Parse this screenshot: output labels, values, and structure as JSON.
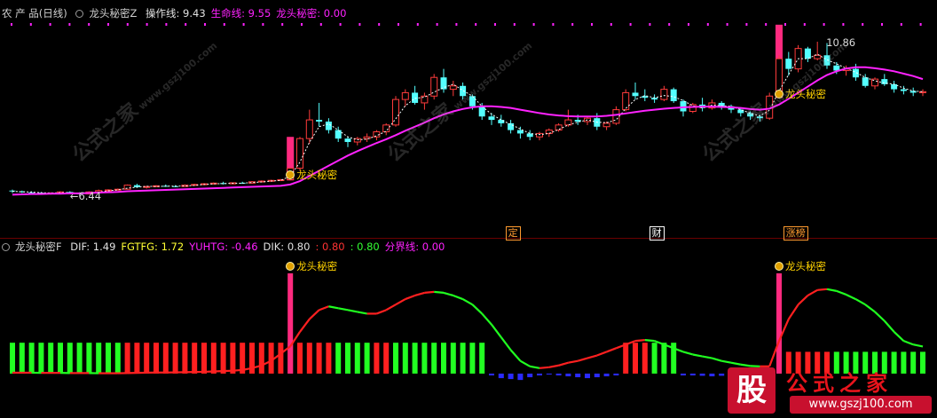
{
  "window": {
    "product": "农 产 品(日线)",
    "main_indicator": "龙头秘密Z",
    "main_items": [
      {
        "text": "操作线: 9.43",
        "color": "#e0e0e0"
      },
      {
        "text": "生命线: 9.55",
        "color": "#ff22ff"
      },
      {
        "text": "龙头秘密: 0.00",
        "color": "#ff22ff"
      }
    ],
    "sub_indicator": "龙头秘密F",
    "sub_items": [
      {
        "text": "DIF: 1.49",
        "color": "#e0e0e0"
      },
      {
        "text": "FGTFG: 1.72",
        "color": "#ffff33"
      },
      {
        "text": "YUHTG: -0.46",
        "color": "#ff22ff"
      },
      {
        "text": "DIK: 0.80",
        "color": "#e0e0e0"
      },
      {
        "text": ": 0.80",
        "color": "#ff3333"
      },
      {
        "text": ": 0.80",
        "color": "#33ff33"
      },
      {
        "text": "分界线: 0.00",
        "color": "#ff22ff"
      }
    ]
  },
  "chart_data": [
    {
      "type": "candlestick",
      "price_range": [
        5.6,
        11.5
      ],
      "high_label": "10.86",
      "low_label": "6.44",
      "signal_label": "龙头秘密",
      "colors": {
        "up": "#ff3b3b",
        "down": "#54ffff",
        "life_line": "#ff22ff",
        "op_line": "#ffffff"
      },
      "candles": [
        [
          6.52,
          6.55,
          6.45,
          6.5
        ],
        [
          6.5,
          6.52,
          6.45,
          6.47
        ],
        [
          6.47,
          6.5,
          6.43,
          6.46
        ],
        [
          6.46,
          6.48,
          6.42,
          6.44
        ],
        [
          6.44,
          6.47,
          6.4,
          6.45
        ],
        [
          6.45,
          6.5,
          6.43,
          6.48
        ],
        [
          6.48,
          6.5,
          6.42,
          6.44
        ],
        [
          6.44,
          6.47,
          6.4,
          6.42
        ],
        [
          6.42,
          6.5,
          6.41,
          6.48
        ],
        [
          6.48,
          6.55,
          6.46,
          6.52
        ],
        [
          6.52,
          6.56,
          6.5,
          6.54
        ],
        [
          6.54,
          6.58,
          6.52,
          6.56
        ],
        [
          6.56,
          6.7,
          6.55,
          6.68
        ],
        [
          6.68,
          6.72,
          6.6,
          6.62
        ],
        [
          6.62,
          6.66,
          6.58,
          6.64
        ],
        [
          6.64,
          6.68,
          6.62,
          6.66
        ],
        [
          6.66,
          6.7,
          6.63,
          6.65
        ],
        [
          6.65,
          6.68,
          6.62,
          6.64
        ],
        [
          6.64,
          6.7,
          6.63,
          6.68
        ],
        [
          6.68,
          6.72,
          6.66,
          6.7
        ],
        [
          6.7,
          6.74,
          6.68,
          6.72
        ],
        [
          6.72,
          6.76,
          6.7,
          6.74
        ],
        [
          6.74,
          6.78,
          6.7,
          6.72
        ],
        [
          6.72,
          6.76,
          6.7,
          6.75
        ],
        [
          6.75,
          6.78,
          6.72,
          6.74
        ],
        [
          6.74,
          6.8,
          6.73,
          6.78
        ],
        [
          6.78,
          6.82,
          6.76,
          6.8
        ],
        [
          6.8,
          6.84,
          6.78,
          6.82
        ],
        [
          6.82,
          6.86,
          6.8,
          6.84
        ],
        [
          6.84,
          7.2,
          6.82,
          7.18
        ],
        [
          7.18,
          8.1,
          7.1,
          8.05
        ],
        [
          8.05,
          8.9,
          7.9,
          8.6
        ],
        [
          8.6,
          9.1,
          8.4,
          8.55
        ],
        [
          8.55,
          8.65,
          8.2,
          8.3
        ],
        [
          8.3,
          8.4,
          7.95,
          8.05
        ],
        [
          8.05,
          8.1,
          7.8,
          7.95
        ],
        [
          7.95,
          8.1,
          7.85,
          8.05
        ],
        [
          8.05,
          8.2,
          7.95,
          8.1
        ],
        [
          8.1,
          8.3,
          8.0,
          8.25
        ],
        [
          8.25,
          8.5,
          8.15,
          8.45
        ],
        [
          8.45,
          9.3,
          8.4,
          9.2
        ],
        [
          9.2,
          9.5,
          9.0,
          9.4
        ],
        [
          9.4,
          9.6,
          9.05,
          9.1
        ],
        [
          9.1,
          9.4,
          8.9,
          9.3
        ],
        [
          9.3,
          9.95,
          9.2,
          9.85
        ],
        [
          9.85,
          10.1,
          9.4,
          9.5
        ],
        [
          9.5,
          9.75,
          9.3,
          9.6
        ],
        [
          9.6,
          9.7,
          9.2,
          9.3
        ],
        [
          9.3,
          9.35,
          8.9,
          9.0
        ],
        [
          9.0,
          9.1,
          8.6,
          8.7
        ],
        [
          8.7,
          8.8,
          8.45,
          8.6
        ],
        [
          8.6,
          8.75,
          8.4,
          8.5
        ],
        [
          8.5,
          8.6,
          8.2,
          8.3
        ],
        [
          8.3,
          8.4,
          8.05,
          8.2
        ],
        [
          8.2,
          8.3,
          8.0,
          8.1
        ],
        [
          8.1,
          8.25,
          8.0,
          8.2
        ],
        [
          8.2,
          8.35,
          8.1,
          8.3
        ],
        [
          8.3,
          8.5,
          8.25,
          8.45
        ],
        [
          8.45,
          8.9,
          8.4,
          8.6
        ],
        [
          8.6,
          8.75,
          8.45,
          8.55
        ],
        [
          8.55,
          8.7,
          8.45,
          8.65
        ],
        [
          8.65,
          8.8,
          8.3,
          8.4
        ],
        [
          8.4,
          8.55,
          8.3,
          8.5
        ],
        [
          8.5,
          9.0,
          8.45,
          8.9
        ],
        [
          8.9,
          9.5,
          8.85,
          9.4
        ],
        [
          9.4,
          9.7,
          9.2,
          9.3
        ],
        [
          9.3,
          9.5,
          9.15,
          9.25
        ],
        [
          9.25,
          9.35,
          9.1,
          9.2
        ],
        [
          9.2,
          9.6,
          9.15,
          9.5
        ],
        [
          9.5,
          9.55,
          9.1,
          9.15
        ],
        [
          9.15,
          9.2,
          8.7,
          8.85
        ],
        [
          8.85,
          9.1,
          8.8,
          9.05
        ],
        [
          9.05,
          9.25,
          8.85,
          8.95
        ],
        [
          8.95,
          9.2,
          8.9,
          9.1
        ],
        [
          9.1,
          9.15,
          8.9,
          9.0
        ],
        [
          9.0,
          9.05,
          8.8,
          8.9
        ],
        [
          8.9,
          8.95,
          8.7,
          8.8
        ],
        [
          8.8,
          8.85,
          8.6,
          8.7
        ],
        [
          8.7,
          8.75,
          8.55,
          8.65
        ],
        [
          8.65,
          9.4,
          8.6,
          9.3
        ],
        [
          9.3,
          10.5,
          9.25,
          10.4
        ],
        [
          10.4,
          10.6,
          9.9,
          10.1
        ],
        [
          10.1,
          10.8,
          10.0,
          10.7
        ],
        [
          10.7,
          10.75,
          10.3,
          10.4
        ],
        [
          10.4,
          10.9,
          10.35,
          10.5
        ],
        [
          10.5,
          10.86,
          10.1,
          10.2
        ],
        [
          10.2,
          10.3,
          9.95,
          10.05
        ],
        [
          10.05,
          10.2,
          9.9,
          10.1
        ],
        [
          10.1,
          10.25,
          9.75,
          9.85
        ],
        [
          9.85,
          9.95,
          9.55,
          9.6
        ],
        [
          9.6,
          9.85,
          9.5,
          9.8
        ],
        [
          9.8,
          9.95,
          9.6,
          9.65
        ],
        [
          9.65,
          9.75,
          9.4,
          9.5
        ],
        [
          9.5,
          9.6,
          9.35,
          9.45
        ],
        [
          9.45,
          9.55,
          9.3,
          9.4
        ],
        [
          9.4,
          9.5,
          9.3,
          9.43
        ]
      ],
      "life_line": [
        6.4,
        6.41,
        6.42,
        6.42,
        6.43,
        6.43,
        6.44,
        6.44,
        6.45,
        6.46,
        6.47,
        6.48,
        6.5,
        6.51,
        6.52,
        6.53,
        6.54,
        6.55,
        6.56,
        6.57,
        6.58,
        6.59,
        6.6,
        6.61,
        6.62,
        6.63,
        6.64,
        6.65,
        6.66,
        6.7,
        6.8,
        6.95,
        7.1,
        7.25,
        7.4,
        7.55,
        7.68,
        7.8,
        7.92,
        8.03,
        8.15,
        8.28,
        8.4,
        8.52,
        8.65,
        8.76,
        8.85,
        8.92,
        8.97,
        9.0,
        9.0,
        8.98,
        8.95,
        8.9,
        8.85,
        8.8,
        8.76,
        8.73,
        8.71,
        8.7,
        8.7,
        8.7,
        8.72,
        8.75,
        8.79,
        8.83,
        8.87,
        8.9,
        8.93,
        8.95,
        8.97,
        8.98,
        8.99,
        8.99,
        8.98,
        8.97,
        8.95,
        8.92,
        8.9,
        8.93,
        9.05,
        9.22,
        9.4,
        9.58,
        9.76,
        9.92,
        10.03,
        10.11,
        10.15,
        10.15,
        10.12,
        10.08,
        10.03,
        9.96,
        9.89,
        9.8
      ],
      "signal_bars": [
        29,
        80
      ],
      "signal_bar_color": "#ff2a7f",
      "markers": [
        {
          "label": "定",
          "index": 52,
          "color": "#ff9b2f"
        },
        {
          "label": "财",
          "index": 67,
          "color": "#ffffff"
        },
        {
          "label": "涨榜",
          "index": 81,
          "color": "#ff9b2f"
        }
      ]
    },
    {
      "type": "oscillator",
      "value_range": [
        -2.2,
        6.4
      ],
      "signal_label": "龙头秘密",
      "dif": [
        0.05,
        0.05,
        0.05,
        0.04,
        0.04,
        0.04,
        0.03,
        0.03,
        0.03,
        0.02,
        0.02,
        0.02,
        0.03,
        0.04,
        0.05,
        0.06,
        0.06,
        0.07,
        0.08,
        0.09,
        0.1,
        0.12,
        0.14,
        0.16,
        0.2,
        0.3,
        0.45,
        0.7,
        1.1,
        1.5,
        2.3,
        3.0,
        3.5,
        3.7,
        3.6,
        3.5,
        3.4,
        3.3,
        3.3,
        3.5,
        3.8,
        4.1,
        4.3,
        4.45,
        4.5,
        4.45,
        4.3,
        4.1,
        3.8,
        3.3,
        2.7,
        2.0,
        1.3,
        0.7,
        0.4,
        0.3,
        0.35,
        0.45,
        0.6,
        0.7,
        0.85,
        1.0,
        1.2,
        1.4,
        1.6,
        1.8,
        1.85,
        1.8,
        1.6,
        1.4,
        1.2,
        1.05,
        0.95,
        0.85,
        0.7,
        0.6,
        0.5,
        0.42,
        0.4,
        0.4,
        1.8,
        3.0,
        3.8,
        4.3,
        4.6,
        4.65,
        4.55,
        4.35,
        4.1,
        3.8,
        3.4,
        2.9,
        2.3,
        1.8,
        1.6,
        1.49
      ],
      "dif_colors": {
        "rise": "#ff2020",
        "fall": "#20ff20"
      },
      "histogram": [
        1.7,
        1.7,
        1.7,
        1.7,
        1.7,
        1.7,
        1.7,
        1.7,
        1.7,
        1.7,
        1.7,
        1.7,
        1.7,
        1.7,
        1.7,
        1.7,
        1.7,
        1.7,
        1.7,
        1.7,
        1.7,
        1.7,
        1.7,
        1.7,
        1.7,
        1.7,
        1.7,
        1.7,
        1.7,
        1.7,
        1.7,
        1.7,
        1.7,
        1.7,
        1.7,
        1.7,
        1.7,
        1.7,
        1.7,
        1.7,
        1.7,
        1.7,
        1.7,
        1.7,
        1.7,
        1.7,
        1.7,
        1.7,
        1.7,
        1.7,
        -0.1,
        -0.25,
        -0.3,
        -0.35,
        -0.2,
        -0.1,
        -0.05,
        -0.1,
        -0.15,
        -0.2,
        -0.25,
        -0.2,
        -0.15,
        -0.1,
        1.7,
        1.7,
        1.7,
        1.7,
        1.7,
        1.7,
        -0.1,
        -0.1,
        -0.12,
        -0.15,
        -0.12,
        -0.1,
        -0.1,
        -0.08,
        -0.05,
        -0.05,
        1.7,
        1.2,
        1.2,
        1.2,
        1.2,
        1.2,
        1.2,
        1.2,
        1.2,
        1.2,
        1.2,
        1.2,
        1.2,
        1.2,
        1.2,
        1.2
      ],
      "histogram_colors": {
        "up": "#22ff22",
        "down": "#ff2020",
        "negative": "#2a2aff"
      },
      "signal_bars": [
        29,
        80
      ]
    }
  ],
  "branding": {
    "watermark": "公式之家",
    "watermark_url": "www.gszj100.com",
    "logo_char": "股",
    "logo_title": "公式之家",
    "logo_url": "www.gszj100.com"
  }
}
